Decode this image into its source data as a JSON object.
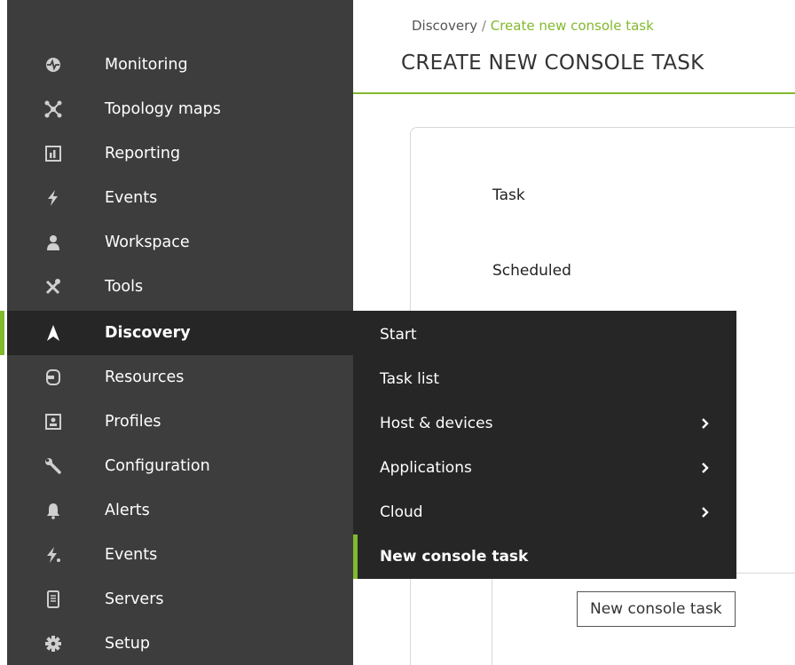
{
  "breadcrumb": {
    "parent": "Discovery",
    "separator": "/",
    "current": "Create new console task"
  },
  "page_title": "CREATE NEW CONSOLE TASK",
  "form": {
    "task_label": "Task",
    "scheduled_label": "Scheduled"
  },
  "sidebar": {
    "items": [
      {
        "label": "Monitoring",
        "icon": "monitoring-icon"
      },
      {
        "label": "Topology maps",
        "icon": "topology-icon"
      },
      {
        "label": "Reporting",
        "icon": "reporting-icon"
      },
      {
        "label": "Events",
        "icon": "events-icon"
      },
      {
        "label": "Workspace",
        "icon": "workspace-icon"
      },
      {
        "label": "Tools",
        "icon": "tools-icon"
      },
      {
        "label": "Discovery",
        "icon": "discovery-icon",
        "active": true
      },
      {
        "label": "Resources",
        "icon": "resources-icon"
      },
      {
        "label": "Profiles",
        "icon": "profiles-icon"
      },
      {
        "label": "Configuration",
        "icon": "configuration-icon"
      },
      {
        "label": "Alerts",
        "icon": "alerts-icon"
      },
      {
        "label": "Events",
        "icon": "server-events-icon"
      },
      {
        "label": "Servers",
        "icon": "servers-icon"
      },
      {
        "label": "Setup",
        "icon": "setup-icon"
      }
    ]
  },
  "submenu": {
    "items": [
      {
        "label": "Start",
        "has_children": false
      },
      {
        "label": "Task list",
        "has_children": false
      },
      {
        "label": "Host & devices",
        "has_children": true
      },
      {
        "label": "Applications",
        "has_children": true
      },
      {
        "label": "Cloud",
        "has_children": true
      },
      {
        "label": "New console task",
        "has_children": false,
        "active": true
      }
    ]
  },
  "tooltip": {
    "text": "New console task"
  },
  "colors": {
    "sidebar_bg": "#3d3d3d",
    "submenu_bg": "#262626",
    "accent": "#82b92e"
  }
}
